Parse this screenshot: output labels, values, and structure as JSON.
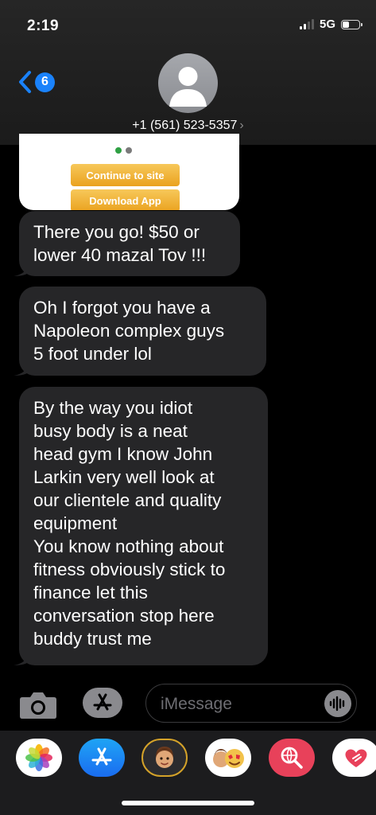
{
  "status_bar": {
    "time": "2:19",
    "network": "5G",
    "battery_level": 0.4
  },
  "header": {
    "back_badge": "6",
    "contact": "+1 (561) 523-5357",
    "chevron": "›"
  },
  "link_preview": {
    "primary_button": "Continue to site",
    "secondary_button": "Download App"
  },
  "messages": [
    {
      "lines": [
        "There you go! $50 or",
        "lower 40 mazal Tov !!!"
      ]
    },
    {
      "lines": [
        "Oh I forgot you have a",
        "Napoleon complex guys",
        "5 foot under lol"
      ]
    },
    {
      "lines": [
        "By the way you idiot",
        "busy body is a neat",
        "head gym I know John",
        "Larkin very well look at",
        "our clientele and quality",
        "equipment",
        "You know nothing about",
        "fitness obviously stick to",
        "finance let this",
        "conversation stop here",
        "buddy trust me"
      ]
    }
  ],
  "composer": {
    "placeholder": "iMessage"
  },
  "app_drawer": {
    "apps": [
      {
        "icon": "photos-icon"
      },
      {
        "icon": "app-store-icon"
      },
      {
        "icon": "memoji-icon"
      },
      {
        "icon": "animoji-icon"
      },
      {
        "icon": "web-search-icon"
      },
      {
        "icon": "digital-touch-icon"
      }
    ]
  },
  "colors": {
    "bubble": "#262628",
    "accent_blue": "#1a82fb",
    "background": "#000000",
    "link_button": "#eaa21f"
  }
}
